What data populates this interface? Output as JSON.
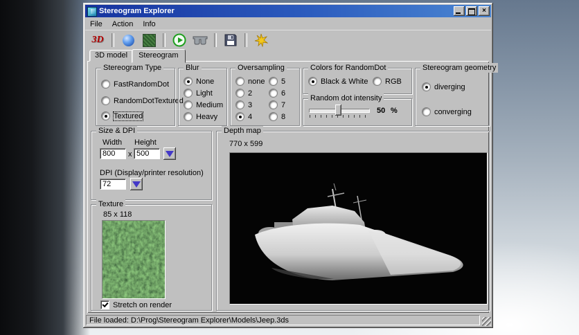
{
  "window": {
    "title": "Stereogram Explorer",
    "close_glyph": "×"
  },
  "menu": {
    "items": [
      {
        "label": "File"
      },
      {
        "label": "Action"
      },
      {
        "label": "Info"
      }
    ]
  },
  "toolbar": {
    "icon_3d_label": "3D"
  },
  "tabs": [
    {
      "label": "3D model",
      "active": false
    },
    {
      "label": "Stereogram",
      "active": true
    }
  ],
  "groups": {
    "stereogram_type": {
      "title": "Stereogram Type",
      "options": [
        {
          "label": "FastRandomDot",
          "selected": false
        },
        {
          "label": "RandomDotTextured",
          "selected": false
        },
        {
          "label": "Textured",
          "selected": true
        }
      ]
    },
    "blur": {
      "title": "Blur",
      "options": [
        {
          "label": "None",
          "selected": true
        },
        {
          "label": "Light",
          "selected": false
        },
        {
          "label": "Medium",
          "selected": false
        },
        {
          "label": "Heavy",
          "selected": false
        }
      ]
    },
    "oversampling": {
      "title": "Oversampling",
      "options": [
        {
          "label": "none",
          "selected": false
        },
        {
          "label": "2",
          "selected": false
        },
        {
          "label": "3",
          "selected": false
        },
        {
          "label": "4",
          "selected": true
        },
        {
          "label": "5",
          "selected": false
        },
        {
          "label": "6",
          "selected": false
        },
        {
          "label": "7",
          "selected": false
        },
        {
          "label": "8",
          "selected": false
        }
      ]
    },
    "colors": {
      "title": "Colors for RandomDot",
      "options": [
        {
          "label": "Black & White",
          "selected": true
        },
        {
          "label": "RGB",
          "selected": false
        }
      ]
    },
    "intensity": {
      "title": "Random dot intensity",
      "value": "50",
      "unit": "%"
    },
    "geometry": {
      "title": "Stereogram geometry",
      "options": [
        {
          "label": "diverging",
          "selected": true
        },
        {
          "label": "converging",
          "selected": false
        }
      ]
    },
    "size_dpi": {
      "title": "Size & DPI",
      "width_label": "Width",
      "height_label": "Height",
      "width_value": "800",
      "height_value": "500",
      "separator": "x",
      "dpi_label": "DPI (Display/printer resolution)",
      "dpi_value": "72"
    },
    "texture": {
      "title": "Texture",
      "dimensions": "85 x 118",
      "stretch_label": "Stretch on render",
      "stretch_checked": true
    },
    "depth_map": {
      "title": "Depth map",
      "dimensions": "770 x 599"
    }
  },
  "status_bar": {
    "text": "File loaded: D:\\Prog\\Stereogram Explorer\\Models\\Jeep.3ds"
  }
}
